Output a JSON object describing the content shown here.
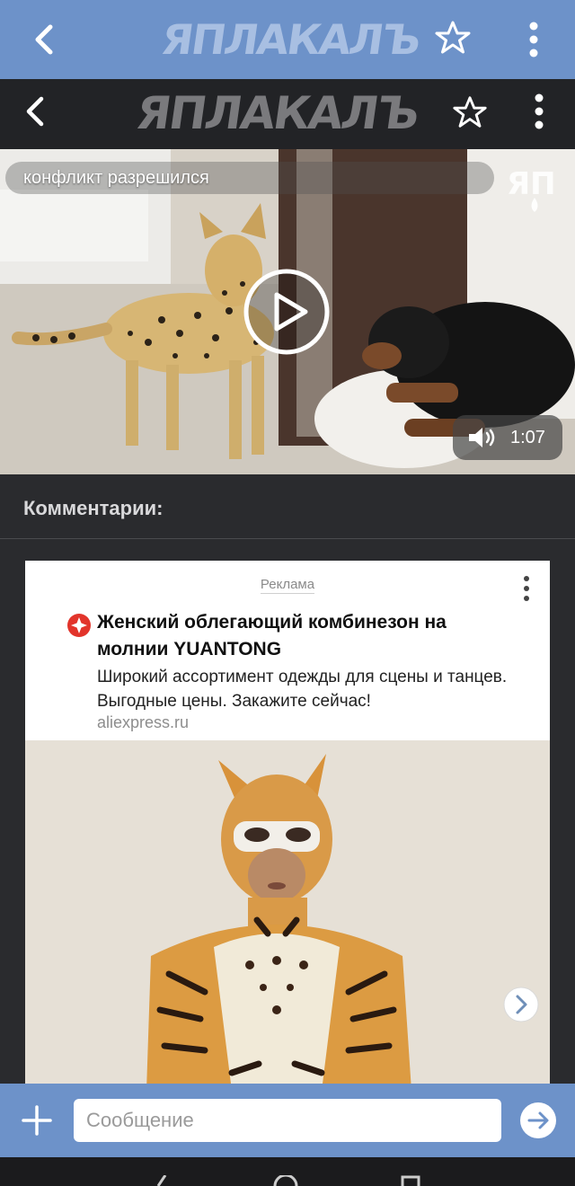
{
  "app": {
    "logo_text": "ЯПЛАКАЛЪ",
    "accent_color": "#6d92c9"
  },
  "header": {
    "back_icon": "chevron-left-icon",
    "star_icon": "star-outline-icon",
    "menu_icon": "kebab-menu-icon"
  },
  "inner_header": {
    "logo_text": "ЯПЛАКАЛЪ"
  },
  "video": {
    "title": "конфликт разрешился",
    "watermark": "ЯП",
    "duration": "1:07",
    "play_icon": "play-icon",
    "volume_icon": "volume-icon"
  },
  "comments": {
    "label": "Комментарии:"
  },
  "ad": {
    "tag": "Реклама",
    "title": "Женский облегающий комбинезон на молнии YUANTONG",
    "description": "Широкий ассортимент одежды для сцены и танцев. Выгодные цены. Закажите сейчас!",
    "domain": "aliexpress.ru",
    "next_icon": "chevron-right-icon"
  },
  "message_bar": {
    "placeholder": "Сообщение",
    "add_icon": "plus-icon",
    "send_icon": "send-arrow-icon"
  }
}
